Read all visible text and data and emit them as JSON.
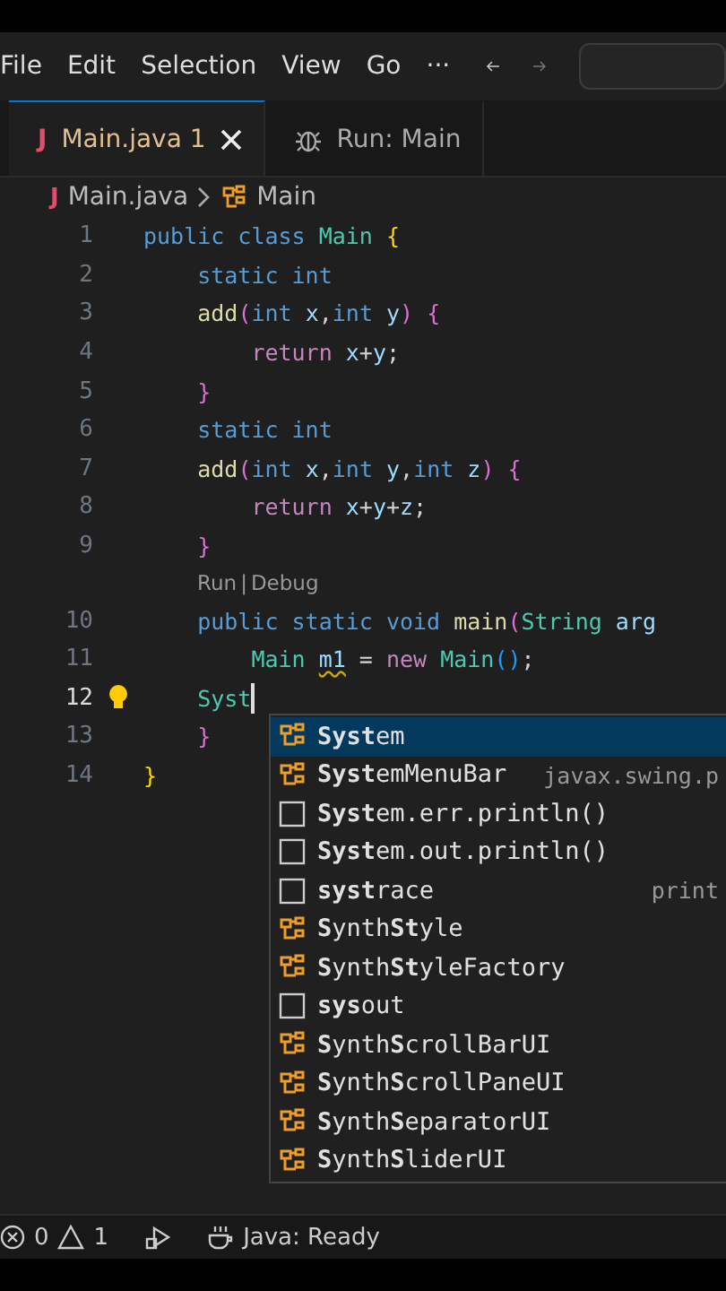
{
  "menu": [
    "File",
    "Edit",
    "Selection",
    "View",
    "Go",
    "···"
  ],
  "tabs": [
    {
      "label": "Main.java 1",
      "kind": "file",
      "glyph": "J",
      "selected": true
    },
    {
      "label": "Run: Main",
      "kind": "run",
      "selected": false
    }
  ],
  "breadcrumb": [
    {
      "label": "Main.java",
      "kind": "file",
      "glyph": "J"
    },
    {
      "label": "Main",
      "kind": "class"
    }
  ],
  "lines": [
    {
      "kind": "code",
      "number": "1",
      "current": false,
      "tokens": [
        {
          "kind": "kw",
          "text": "public class "
        },
        {
          "kind": "type",
          "text": "Main "
        },
        {
          "kind": "b1",
          "text": "{"
        }
      ]
    },
    {
      "kind": "code",
      "number": "2",
      "current": false,
      "tokens": [
        {
          "kind": "kw",
          "text": "    static int"
        }
      ]
    },
    {
      "kind": "code",
      "number": "3",
      "current": false,
      "tokens": [
        {
          "kind": "fn",
          "text": "    add"
        },
        {
          "kind": "b2",
          "text": "("
        },
        {
          "kind": "kw",
          "text": "int "
        },
        {
          "kind": "var",
          "text": "x"
        },
        {
          "kind": "plain",
          "text": ","
        },
        {
          "kind": "kw",
          "text": "int "
        },
        {
          "kind": "var",
          "text": "y"
        },
        {
          "kind": "b2",
          "text": ") {"
        }
      ]
    },
    {
      "kind": "code",
      "number": "4",
      "current": false,
      "tokens": [
        {
          "kind": "ctrl",
          "text": "        return "
        },
        {
          "kind": "var",
          "text": "x"
        },
        {
          "kind": "plain",
          "text": "+"
        },
        {
          "kind": "var",
          "text": "y"
        },
        {
          "kind": "plain",
          "text": ";"
        }
      ]
    },
    {
      "kind": "code",
      "number": "5",
      "current": false,
      "tokens": [
        {
          "kind": "b2",
          "text": "    }"
        }
      ]
    },
    {
      "kind": "code",
      "number": "6",
      "current": false,
      "tokens": [
        {
          "kind": "kw",
          "text": "    static int"
        }
      ]
    },
    {
      "kind": "code",
      "number": "7",
      "current": false,
      "tokens": [
        {
          "kind": "fn",
          "text": "    add"
        },
        {
          "kind": "b2",
          "text": "("
        },
        {
          "kind": "kw",
          "text": "int "
        },
        {
          "kind": "var",
          "text": "x"
        },
        {
          "kind": "plain",
          "text": ","
        },
        {
          "kind": "kw",
          "text": "int "
        },
        {
          "kind": "var",
          "text": "y"
        },
        {
          "kind": "plain",
          "text": ","
        },
        {
          "kind": "kw",
          "text": "int "
        },
        {
          "kind": "var",
          "text": "z"
        },
        {
          "kind": "b2",
          "text": ") {"
        }
      ]
    },
    {
      "kind": "code",
      "number": "8",
      "current": false,
      "tokens": [
        {
          "kind": "ctrl",
          "text": "        return "
        },
        {
          "kind": "var",
          "text": "x"
        },
        {
          "kind": "plain",
          "text": "+"
        },
        {
          "kind": "var",
          "text": "y"
        },
        {
          "kind": "plain",
          "text": "+"
        },
        {
          "kind": "var",
          "text": "z"
        },
        {
          "kind": "plain",
          "text": ";"
        }
      ]
    },
    {
      "kind": "code",
      "number": "9",
      "current": false,
      "tokens": [
        {
          "kind": "b2",
          "text": "    }"
        }
      ]
    },
    {
      "kind": "codelens",
      "links": [
        "Run",
        "Debug"
      ],
      "separator": "|"
    },
    {
      "kind": "code",
      "number": "10",
      "current": false,
      "tokens": [
        {
          "kind": "kw",
          "text": "    public static void "
        },
        {
          "kind": "fn",
          "text": "main"
        },
        {
          "kind": "b2",
          "text": "("
        },
        {
          "kind": "type",
          "text": "String "
        },
        {
          "kind": "var",
          "text": "arg"
        }
      ]
    },
    {
      "kind": "code",
      "number": "11",
      "current": false,
      "tokens": [
        {
          "kind": "type",
          "text": "        Main "
        },
        {
          "kind": "var-warn",
          "text": "m1"
        },
        {
          "kind": "plain",
          "text": " = "
        },
        {
          "kind": "ctrl",
          "text": "new "
        },
        {
          "kind": "type",
          "text": "Main"
        },
        {
          "kind": "b3",
          "text": "()"
        },
        {
          "kind": "plain",
          "text": ";"
        }
      ]
    },
    {
      "kind": "code",
      "number": "12",
      "current": true,
      "tokens": [
        {
          "kind": "type",
          "text": "    Syst"
        }
      ]
    },
    {
      "kind": "code",
      "number": "13",
      "current": false,
      "tokens": [
        {
          "kind": "b2",
          "text": "    }"
        }
      ]
    },
    {
      "kind": "code",
      "number": "14",
      "current": false,
      "tokens": [
        {
          "kind": "b1",
          "text": "}"
        }
      ]
    }
  ],
  "suggestions": [
    {
      "kind": "class",
      "label": "**Syst**em",
      "selected": true
    },
    {
      "kind": "class",
      "label": "**Syst**emMenuBar",
      "detail": "javax.swing.p",
      "selected": false
    },
    {
      "kind": "snippet",
      "label": "**Syst**em.err.println()",
      "selected": false
    },
    {
      "kind": "snippet",
      "label": "**Syst**em.out.println()",
      "selected": false
    },
    {
      "kind": "snippet",
      "label": "**syst**race",
      "detail": "print",
      "selected": false
    },
    {
      "kind": "class",
      "label": "**S**ynth**St**yle",
      "selected": false
    },
    {
      "kind": "class",
      "label": "**S**ynth**St**yleFactory",
      "selected": false
    },
    {
      "kind": "snippet",
      "label": "**sys**out",
      "selected": false
    },
    {
      "kind": "class",
      "label": "**S**ynth**S**crollBarUI",
      "selected": false
    },
    {
      "kind": "class",
      "label": "**S**ynth**S**crollPaneUI",
      "selected": false
    },
    {
      "kind": "class",
      "label": "**S**ynth**S**eparatorUI",
      "selected": false
    },
    {
      "kind": "class",
      "label": "**S**ynth**S**liderUI",
      "selected": false
    }
  ],
  "status": {
    "errors": "0",
    "warnings": "1",
    "language": "Java: Ready"
  }
}
